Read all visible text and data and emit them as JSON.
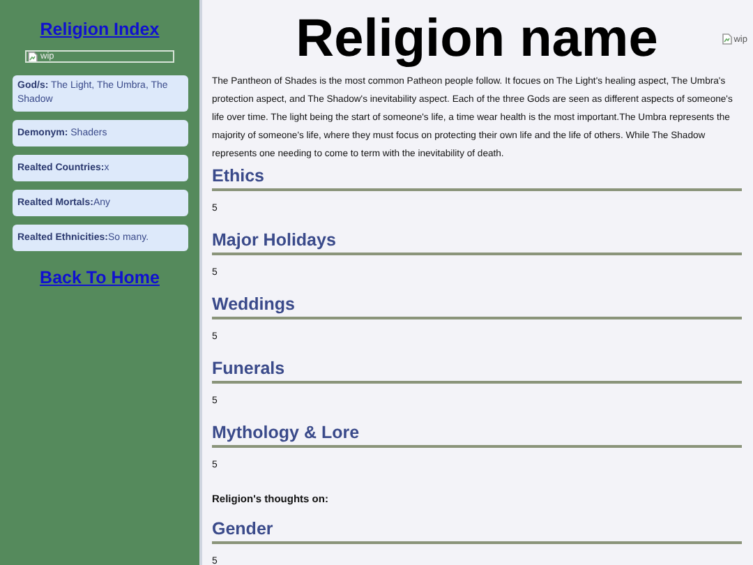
{
  "sidebar": {
    "title": "Religion Index",
    "image_alt": "wip",
    "facts": [
      {
        "label": "God/s:",
        "value": " The Light, The Umbra, The Shadow"
      },
      {
        "label": "Demonym:",
        "value": " Shaders"
      },
      {
        "label": "Realted Countries:",
        "value": "x"
      },
      {
        "label": "Realted Mortals:",
        "value": "Any"
      },
      {
        "label": "Realted Ethnicities:",
        "value": "So many."
      }
    ],
    "home_link": "Back To Home"
  },
  "main": {
    "title": "Religion name",
    "image_alt": "wip",
    "description": "The Pantheon of Shades is the most common Patheon people follow. It focues on The Light's healing aspect, The Umbra's protection aspect, and The Shadow's inevitability aspect. Each of the three Gods are seen as different aspects of someone's life over time. The light being the start of someone's life, a time wear health is the most important.The Umbra represents the majority of someone's life, where they must focus on protecting their own life and the life of others. While The Shadow represents one needing to come to term with the inevitability of death.",
    "sections": [
      {
        "kind": "section",
        "heading": "Ethics",
        "value": "5"
      },
      {
        "kind": "section",
        "heading": "Major Holidays",
        "value": "5"
      },
      {
        "kind": "section",
        "heading": "Weddings",
        "value": "5"
      },
      {
        "kind": "section",
        "heading": "Funerals",
        "value": "5"
      },
      {
        "kind": "section",
        "heading": "Mythology & Lore",
        "value": "5"
      },
      {
        "kind": "note",
        "text": "Religion's thoughts on:"
      },
      {
        "kind": "section",
        "heading": "Gender",
        "value": "5"
      }
    ]
  }
}
